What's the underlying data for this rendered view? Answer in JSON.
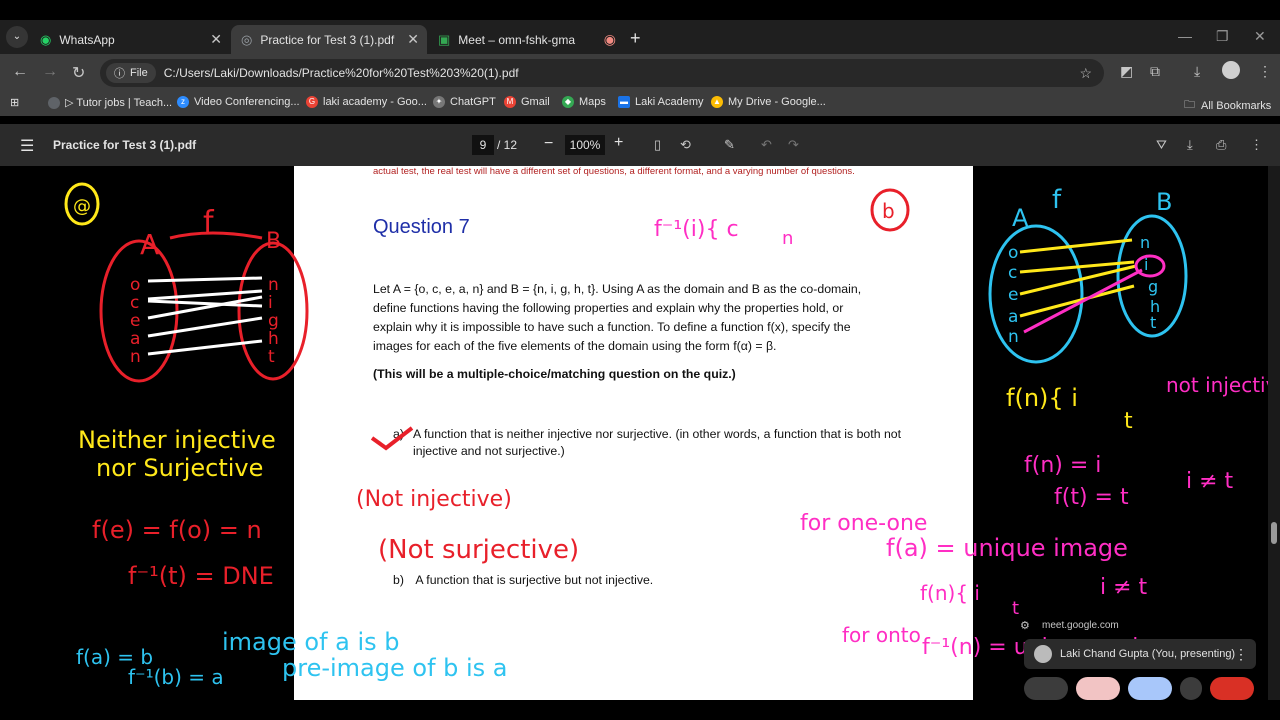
{
  "tabs": [
    {
      "title": "WhatsApp",
      "icon": "whatsapp-icon"
    },
    {
      "title": "Practice for Test 3 (1).pdf",
      "icon": "pdf-icon"
    },
    {
      "title": "Meet – omn-fshk-gma",
      "icon": "meet-icon"
    }
  ],
  "omnibox": {
    "chip": "File",
    "url": "C:/Users/Laki/Downloads/Practice%20for%20Test%203%20(1).pdf"
  },
  "bookmarks": [
    {
      "label": "▷ Tutor jobs | Teach...",
      "icon": "tutor-icon",
      "color": "#5f6368"
    },
    {
      "label": "Video Conferencing...",
      "icon": "zoom-icon",
      "color": "#2d8cff"
    },
    {
      "label": "laki academy - Goo...",
      "icon": "google-icon",
      "color": "#ea4335"
    },
    {
      "label": "ChatGPT",
      "icon": "chatgpt-icon",
      "color": "#cccccc"
    },
    {
      "label": "Gmail",
      "icon": "gmail-icon",
      "color": "#ea4335"
    },
    {
      "label": "Maps",
      "icon": "maps-icon",
      "color": "#34a853"
    },
    {
      "label": "Laki Academy",
      "icon": "academy-icon",
      "color": "#1a73e8"
    },
    {
      "label": "My Drive - Google...",
      "icon": "drive-icon",
      "color": "#fbbc04"
    }
  ],
  "all_bookmarks": "All Bookmarks",
  "pdf": {
    "title": "Practice for Test 3 (1).pdf",
    "page": "9",
    "page_total": "/ 12",
    "zoom": "100%"
  },
  "document": {
    "notice": "actual test, the real test will have a different set of questions, a different format, and a varying number of questions.",
    "question_title": "Question 7",
    "question_text": "Let A = {o, c, e, a, n} and B = {n, i, g, h, t}.  Using A as the domain and B as the co-domain, define functions having the following properties and explain why the properties hold, or explain why it is impossible to have such a function. To define a function f(x), specify the images for each of the five elements of the domain using the form f(α) = β.",
    "note": "(This will be a multiple-choice/matching question on the quiz.)",
    "part_a_label": "a)",
    "part_a_text": "A function that is neither injective nor surjective. (in other words, a function that is both not injective and not surjective.)",
    "part_b_label": "b)",
    "part_b_text": "A function that is surjective but not injective."
  },
  "annotations": {
    "left": [
      "@",
      "A",
      "f",
      "B",
      "o",
      "c",
      "e",
      "a",
      "n",
      "n",
      "i",
      "g",
      "h",
      "t",
      "Neither injective",
      "nor Surjective",
      "f(e) = f(o) = n",
      "f⁻¹(t) = DNE",
      "f(a) = b",
      "f⁻¹(b) = a",
      "image of a is b",
      "pre-image of b is a"
    ],
    "page": [
      "f⁻¹(i){ c",
      "n",
      "b",
      "(Not injective)",
      "(Not surjective)"
    ],
    "right": [
      "A",
      "f",
      "B",
      "o",
      "c",
      "e",
      "a",
      "n",
      "n",
      "i",
      "g",
      "h",
      "t",
      "f(n){ i",
      "t",
      "not injective",
      "f(n) = i",
      "f(t) = t",
      "i ≠ t",
      "for one-one",
      "f(a) = unique image",
      "f(n){ i",
      "t",
      "i ≠ t",
      "for onto",
      "f⁻¹(n) = unique preimage"
    ]
  },
  "meet_overlay": {
    "url": "meet.google.com",
    "presenter": "Laki Chand Gupta (You, presenting)"
  },
  "colors": {
    "red_ink": "#e8202a",
    "yellow_ink": "#ffe81a",
    "cyan_ink": "#2ec3f0",
    "magenta_ink": "#ff2ec4",
    "question_blue": "#1f2fa8",
    "notice_red": "#b22222"
  }
}
